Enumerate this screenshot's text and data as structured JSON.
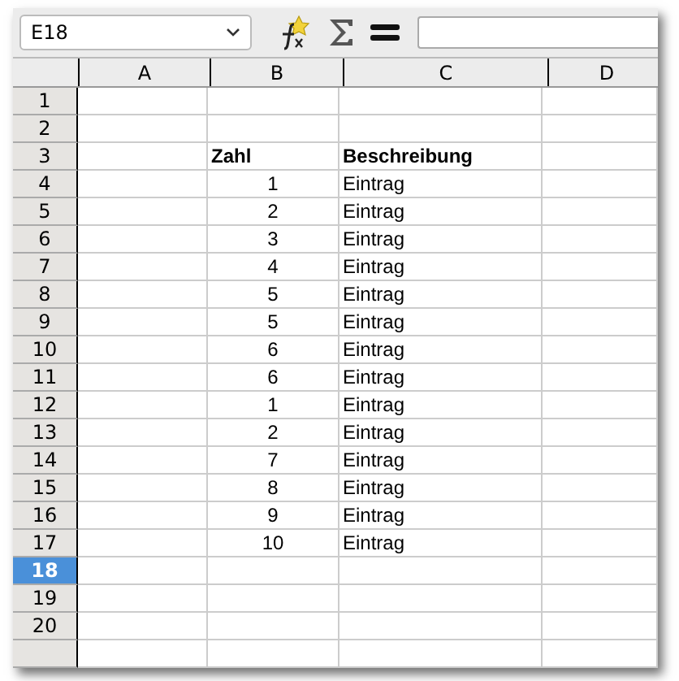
{
  "name_box": {
    "value": "E18"
  },
  "columns": [
    "A",
    "B",
    "C",
    "D"
  ],
  "rows": [
    {
      "header": "1",
      "selected": false,
      "cells": [
        "",
        "",
        ""
      ]
    },
    {
      "header": "2",
      "selected": false,
      "cells": [
        "",
        "",
        ""
      ]
    },
    {
      "header": "3",
      "selected": false,
      "cells": [
        "",
        "Zahl",
        "Beschreibung"
      ],
      "kind": "heading"
    },
    {
      "header": "4",
      "selected": false,
      "cells": [
        "",
        "1",
        "Eintrag"
      ]
    },
    {
      "header": "5",
      "selected": false,
      "cells": [
        "",
        "2",
        "Eintrag"
      ]
    },
    {
      "header": "6",
      "selected": false,
      "cells": [
        "",
        "3",
        "Eintrag"
      ]
    },
    {
      "header": "7",
      "selected": false,
      "cells": [
        "",
        "4",
        "Eintrag"
      ]
    },
    {
      "header": "8",
      "selected": false,
      "cells": [
        "",
        "5",
        "Eintrag"
      ]
    },
    {
      "header": "9",
      "selected": false,
      "cells": [
        "",
        "5",
        "Eintrag"
      ]
    },
    {
      "header": "10",
      "selected": false,
      "cells": [
        "",
        "6",
        "Eintrag"
      ]
    },
    {
      "header": "11",
      "selected": false,
      "cells": [
        "",
        "6",
        "Eintrag"
      ]
    },
    {
      "header": "12",
      "selected": false,
      "cells": [
        "",
        "1",
        "Eintrag"
      ]
    },
    {
      "header": "13",
      "selected": false,
      "cells": [
        "",
        "2",
        "Eintrag"
      ]
    },
    {
      "header": "14",
      "selected": false,
      "cells": [
        "",
        "7",
        "Eintrag"
      ]
    },
    {
      "header": "15",
      "selected": false,
      "cells": [
        "",
        "8",
        "Eintrag"
      ]
    },
    {
      "header": "16",
      "selected": false,
      "cells": [
        "",
        "9",
        "Eintrag"
      ]
    },
    {
      "header": "17",
      "selected": false,
      "cells": [
        "",
        "10",
        "Eintrag"
      ]
    },
    {
      "header": "18",
      "selected": true,
      "cells": [
        "",
        "",
        ""
      ]
    },
    {
      "header": "19",
      "selected": false,
      "cells": [
        "",
        "",
        ""
      ]
    },
    {
      "header": "20",
      "selected": false,
      "cells": [
        "",
        "",
        ""
      ]
    }
  ]
}
